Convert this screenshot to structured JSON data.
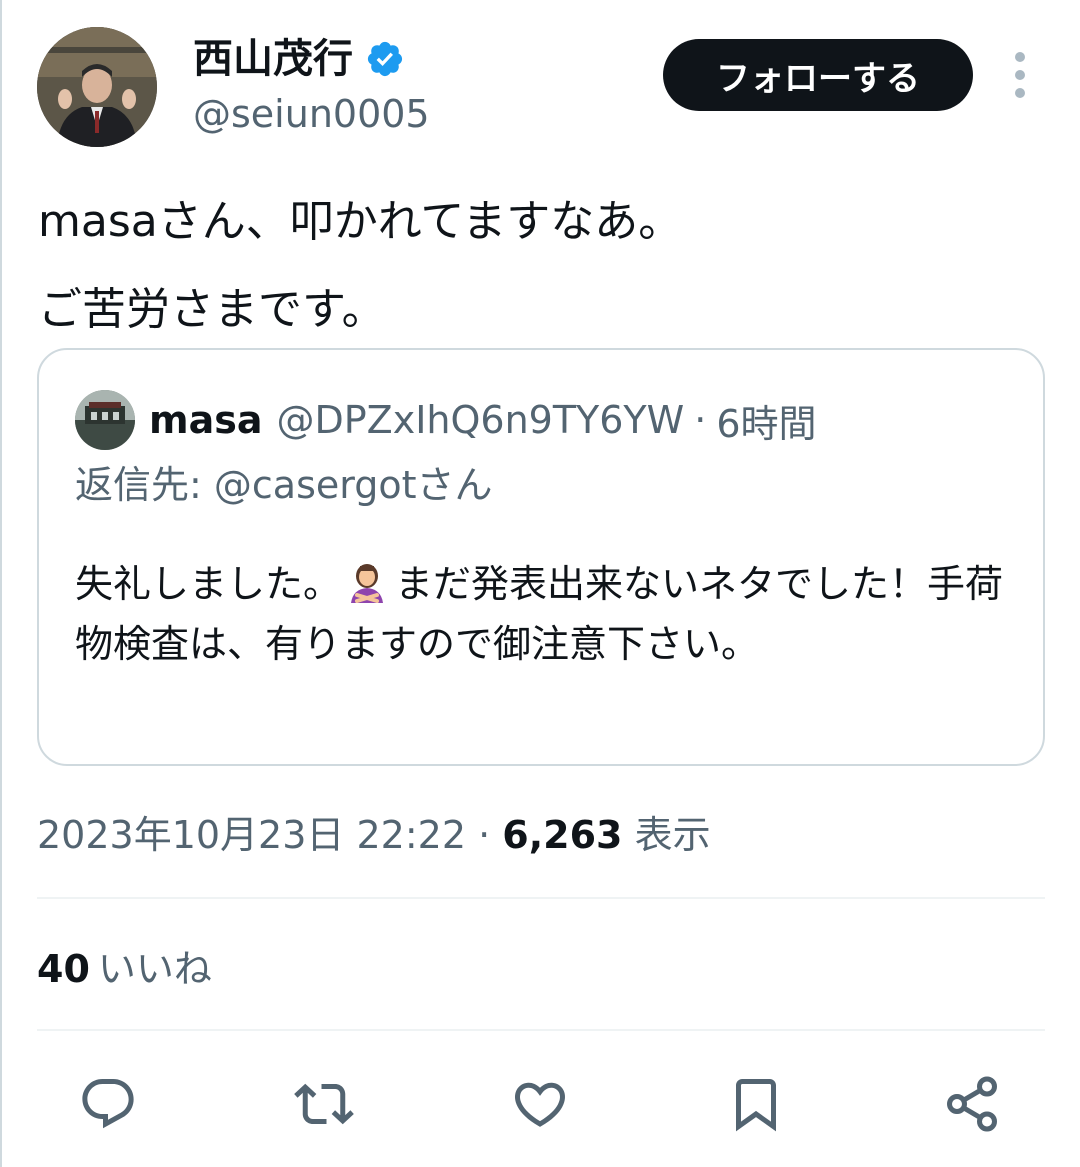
{
  "author": {
    "display_name": "西山茂行",
    "handle": "@seiun0005",
    "verified_icon": "verified-badge-icon",
    "avatar_icon": "profile-avatar"
  },
  "follow_button": "フォローする",
  "tweet": {
    "lines": [
      "masaさん、叩かれてますなあ。",
      "ご苦労さまです。"
    ]
  },
  "quote": {
    "name": "masa",
    "handle": "@DPZxIhQ6n9TY6YW",
    "separator": "·",
    "time": "6時間",
    "reply_prefix": "返信先: ",
    "reply_to": "@casergotさん",
    "text_before_emoji": "失礼しました。",
    "emoji": "🙅‍♀️",
    "text_after_emoji": "まだ発表出来ないネタでした！手荷物検査は、有りますので御注意下さい。"
  },
  "meta": {
    "timestamp": "2023年10月23日 22:22",
    "separator": "·",
    "views_count": "6,263",
    "views_label": "表示"
  },
  "likes": {
    "count": "40",
    "label": "いいね"
  },
  "actions": [
    "reply-icon",
    "retweet-icon",
    "like-icon",
    "bookmark-icon",
    "share-icon"
  ],
  "colors": {
    "text_primary": "#0f1419",
    "text_secondary": "#536471",
    "border": "#cfd9de",
    "verified_blue": "#1d9bf0"
  }
}
